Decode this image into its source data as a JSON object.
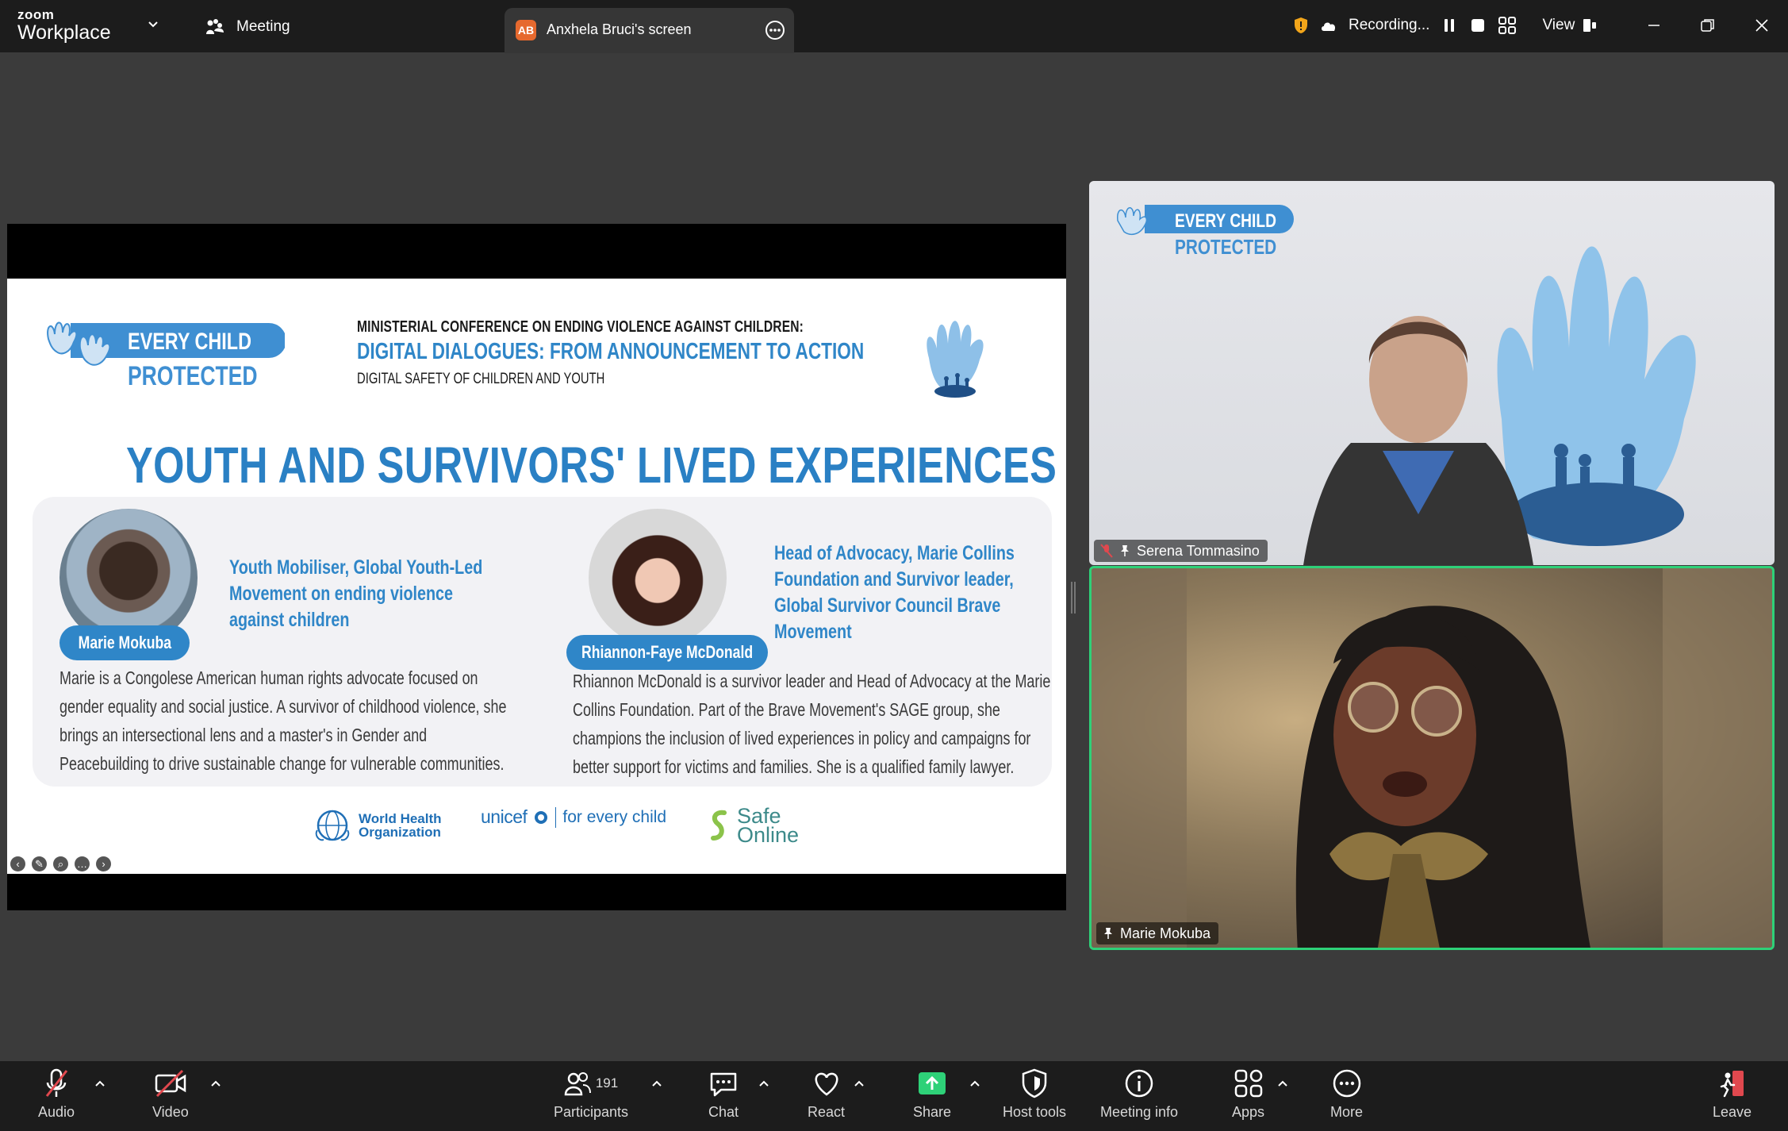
{
  "app": {
    "brand_small": "zoom",
    "brand_large": "Workplace"
  },
  "tabs": {
    "meeting": "Meeting",
    "screen_initials": "AB",
    "screen": "Anxhela Bruci's screen"
  },
  "recording": {
    "status": "Recording...",
    "view": "View"
  },
  "slide": {
    "logo_line1": "EVERY CHILD",
    "logo_line2": "PROTECTED",
    "conf_line1": "MINISTERIAL CONFERENCE ON ENDING VIOLENCE AGAINST CHILDREN:",
    "conf_line2": "DIGITAL DIALOGUES: FROM ANNOUNCEMENT TO ACTION",
    "conf_line3": "DIGITAL SAFETY OF CHILDREN AND YOUTH",
    "title": "YOUTH AND SURVIVORS' LIVED EXPERIENCES",
    "speaker1": {
      "name": "Marie Mokuba",
      "role": [
        "Youth Mobiliser, Global Youth-Led",
        "Movement on ending violence",
        "against children"
      ],
      "bio": [
        "Marie is a Congolese American human rights advocate focused on",
        "gender equality and social justice. A survivor of childhood violence, she",
        "brings an intersectional lens and a master's in Gender and",
        "Peacebuilding to drive sustainable change for vulnerable communities."
      ]
    },
    "speaker2": {
      "name": "Rhiannon-Faye McDonald",
      "role": [
        "Head of Advocacy, Marie Collins",
        "Foundation and Survivor leader,",
        "Global Survivor Council Brave",
        "Movement"
      ],
      "bio": [
        "Rhiannon McDonald is a survivor leader and Head of Advocacy at the Marie",
        "Collins Foundation. Part of the Brave Movement's SAGE group, she",
        "champions the inclusion of lived experiences in policy and campaigns for",
        "better support for victims and families. She is a qualified family lawyer."
      ]
    },
    "sponsors": {
      "who1": "World Health",
      "who2": "Organization",
      "unicef": "unicef",
      "unicef_tag": "for every child",
      "safe1": "Safe",
      "safe2": "Online"
    }
  },
  "participants": {
    "tile1": {
      "name": "Serena Tommasino",
      "logo1": "EVERY CHILD",
      "logo2": "PROTECTED"
    },
    "tile2": {
      "name": "Marie Mokuba"
    }
  },
  "toolbar": {
    "audio": "Audio",
    "video": "Video",
    "participants": "Participants",
    "participants_count": "191",
    "chat": "Chat",
    "react": "React",
    "share": "Share",
    "host_tools": "Host tools",
    "meeting_info": "Meeting info",
    "apps": "Apps",
    "more": "More",
    "leave": "Leave"
  },
  "colors": {
    "accent_blue": "#2f86c8",
    "share_green": "#2ed178",
    "leave_red": "#e0484e",
    "speaking_border": "#2ed178"
  }
}
